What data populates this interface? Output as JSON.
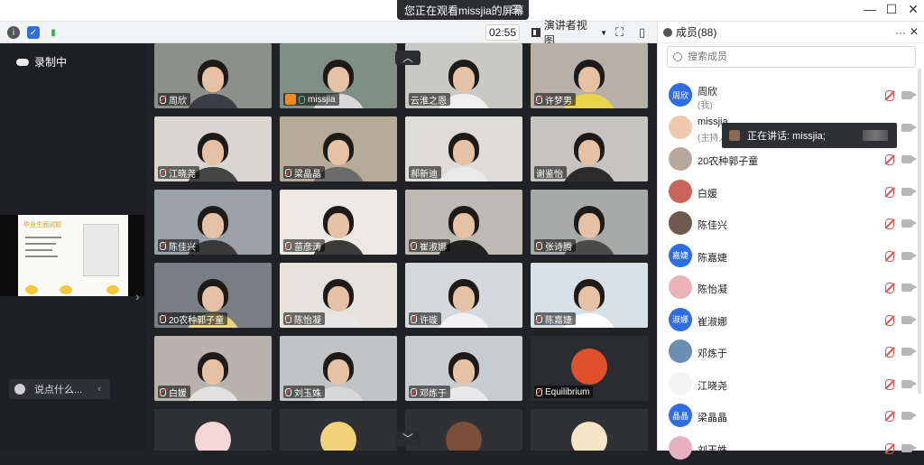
{
  "titlebar": {
    "share_status": "您正在观看missjia的屏幕",
    "share_menu_icon": "list-icon"
  },
  "toolbar": {
    "timer": "02:55",
    "view_mode": "演讲者视图",
    "icons": [
      "info-icon",
      "shield-icon",
      "signal-icon",
      "fullscreen-icon",
      "sidebar-toggle-icon"
    ]
  },
  "left": {
    "recording": "录制中",
    "slide_title": "毕业生面试题",
    "chat_placeholder": "说点什么..."
  },
  "tiles": [
    {
      "name": "周欣",
      "mic": "muted"
    },
    {
      "name": "missjia",
      "mic": "on",
      "host": true
    },
    {
      "name": "云淮之恩",
      "mic": "none"
    },
    {
      "name": "许梦男",
      "mic": "muted"
    },
    {
      "name": "江晓尧",
      "mic": "muted"
    },
    {
      "name": "梁晶晶",
      "mic": "muted"
    },
    {
      "name": "郝新迪",
      "mic": "none"
    },
    {
      "name": "谢鉴怡",
      "mic": "none"
    },
    {
      "name": "陈佳兴",
      "mic": "muted"
    },
    {
      "name": "苗彦涛",
      "mic": "muted"
    },
    {
      "name": "崔淑娜",
      "mic": "muted"
    },
    {
      "name": "张诗腾",
      "mic": "muted"
    },
    {
      "name": "20农种郭子童",
      "mic": "muted"
    },
    {
      "name": "陈怡凝",
      "mic": "muted"
    },
    {
      "name": "许璇",
      "mic": "muted"
    },
    {
      "name": "陈嘉婕",
      "mic": "muted"
    },
    {
      "name": "白媛",
      "mic": "muted"
    },
    {
      "name": "刘玉姝",
      "mic": "muted"
    },
    {
      "name": "邓炼于",
      "mic": "muted"
    },
    {
      "name": "Equilibrium",
      "mic": "muted"
    },
    {
      "name": "",
      "mic": "none"
    },
    {
      "name": "",
      "mic": "none"
    },
    {
      "name": "",
      "mic": "none"
    },
    {
      "name": "",
      "mic": "none"
    }
  ],
  "members_panel": {
    "title": "成员(88)",
    "search_placeholder": "搜索成员",
    "speaking_banner": "正在讲话: missjia;",
    "members": [
      {
        "name": "周欣",
        "sub": "(我)",
        "avatar_text": "周欣",
        "avatar_color": "#2f6de0"
      },
      {
        "name": "missjia",
        "sub": "(主持人)",
        "avatar_text": "",
        "avatar_color": "#f0c8b0"
      },
      {
        "name": "20农种郭子童",
        "sub": "",
        "avatar_text": "",
        "avatar_color": "#b7a99a"
      },
      {
        "name": "白媛",
        "sub": "",
        "avatar_text": "",
        "avatar_color": "#c8655a"
      },
      {
        "name": "陈佳兴",
        "sub": "",
        "avatar_text": "",
        "avatar_color": "#6d5a4d"
      },
      {
        "name": "陈嘉婕",
        "sub": "",
        "avatar_text": "嘉婕",
        "avatar_color": "#2f6de0"
      },
      {
        "name": "陈怡凝",
        "sub": "",
        "avatar_text": "",
        "avatar_color": "#e9b3b8"
      },
      {
        "name": "崔淑娜",
        "sub": "",
        "avatar_text": "淑娜",
        "avatar_color": "#2f6de0"
      },
      {
        "name": "邓炼于",
        "sub": "",
        "avatar_text": "",
        "avatar_color": "#6a8fb0"
      },
      {
        "name": "江晓尧",
        "sub": "",
        "avatar_text": "",
        "avatar_color": "#f4f4f4"
      },
      {
        "name": "梁晶晶",
        "sub": "",
        "avatar_text": "晶晶",
        "avatar_color": "#2f6de0"
      },
      {
        "name": "刘玉姝",
        "sub": "",
        "avatar_text": "",
        "avatar_color": "#e7b0c0"
      }
    ]
  },
  "colors": {
    "accent_blue": "#2f6de0",
    "dark_bg": "#202226",
    "muted_red": "#d55555"
  }
}
